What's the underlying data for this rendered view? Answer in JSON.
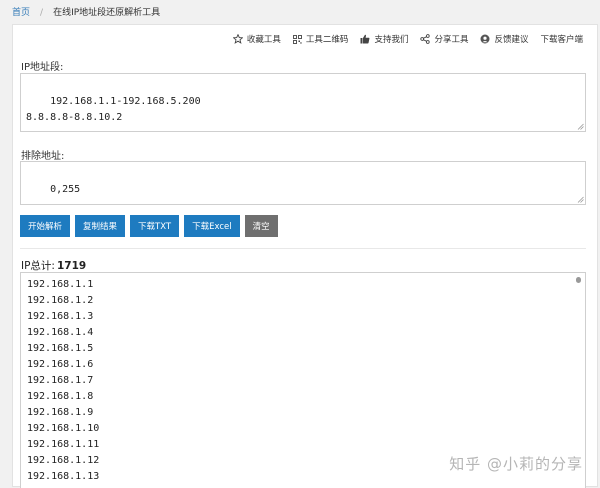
{
  "breadcrumb": {
    "home": "首页",
    "separator": "/",
    "current": "在线IP地址段还原解析工具"
  },
  "toolbar": {
    "items": [
      {
        "label": "收藏工具",
        "icon": "star-icon"
      },
      {
        "label": "工具二维码",
        "icon": "qrcode-icon"
      },
      {
        "label": "支持我们",
        "icon": "thumbs-up-icon"
      },
      {
        "label": "分享工具",
        "icon": "share-icon"
      },
      {
        "label": "反馈建议",
        "icon": "feedback-icon"
      },
      {
        "label": "下载客户端",
        "icon": ""
      }
    ]
  },
  "ip_field": {
    "label": "IP地址段:",
    "value": "192.168.1.1-192.168.5.200\n8.8.8.8-8.8.10.2"
  },
  "exclude_field": {
    "label": "排除地址:",
    "value": "0,255"
  },
  "buttons": {
    "parse": "开始解析",
    "copy": "复制结果",
    "download_txt": "下载TXT",
    "download_excel": "下载Excel",
    "clear": "清空"
  },
  "result": {
    "total_label": "IP总计:",
    "total_value": "1719",
    "lines": [
      "192.168.1.1",
      "192.168.1.2",
      "192.168.1.3",
      "192.168.1.4",
      "192.168.1.5",
      "192.168.1.6",
      "192.168.1.7",
      "192.168.1.8",
      "192.168.1.9",
      "192.168.1.10",
      "192.168.1.11",
      "192.168.1.12",
      "192.168.1.13"
    ]
  },
  "watermark": "知乎 @小莉的分享",
  "colors": {
    "primary_button": "#1e7bc0",
    "clear_button": "#6f6f6f",
    "link": "#337ab7"
  }
}
